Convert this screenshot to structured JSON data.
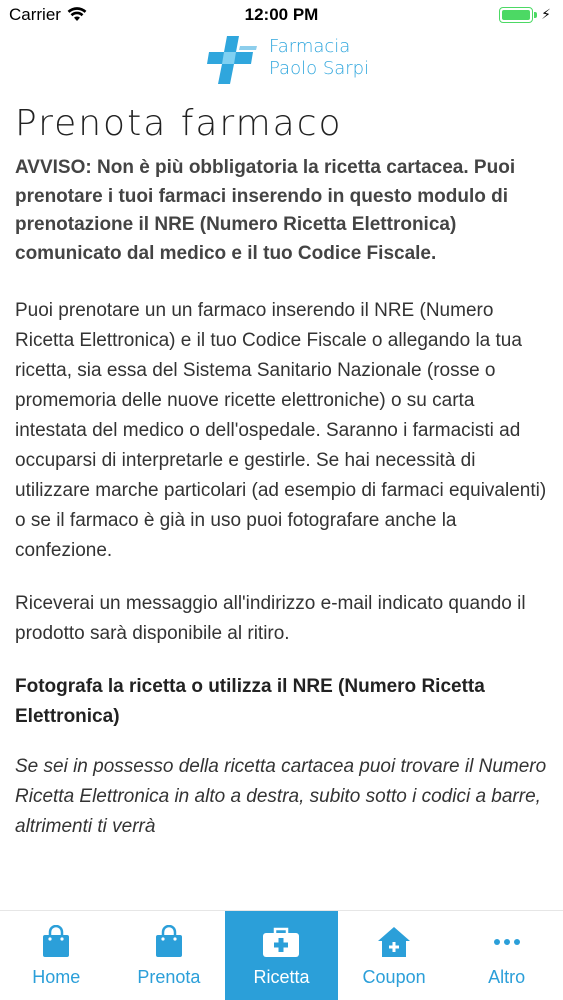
{
  "status_bar": {
    "carrier": "Carrier",
    "time": "12:00 PM",
    "battery_icon": "battery-full-icon",
    "wifi_icon": "wifi-icon"
  },
  "header": {
    "logo_line1": "Farmacia",
    "logo_line2": "Paolo Sarpi",
    "logo_icon": "pharmacy-cross-icon",
    "brand_color": "#2fa6dd"
  },
  "main": {
    "title": "Prenota farmaco",
    "notice": "AVVISO: Non è più obbligatoria la ricetta cartacea. Puoi prenotare i tuoi farmaci inserendo in questo modulo di prenotazione il NRE (Numero Ricetta Elettronica) comunicato dal medico e il tuo Codice Fiscale.",
    "paragraph1": "Puoi prenotare un un farmaco inserendo il NRE (Numero Ricetta Elettronica) e il tuo Codice Fiscale o allegando la tua ricetta, sia essa del Sistema Sanitario Nazionale (rosse o promemoria delle nuove ricette elettroniche) o su carta intestata del medico o dell'ospedale. Saranno i farmacisti ad occuparsi di interpretarle e gestirle. Se hai necessità di utilizzare marche particolari (ad esempio di farmaci equivalenti) o se il farmaco è già in uso puoi fotografare anche la confezione.",
    "paragraph2": "Riceverai un messaggio all'indirizzo e-mail indicato quando il prodotto sarà disponibile al ritiro.",
    "section_heading": "Fotografa la ricetta o utilizza il NRE (Numero Ricetta Elettronica)",
    "italic_text": "Se sei in possesso della ricetta cartacea puoi trovare il Numero Ricetta Elettronica in alto a destra, subito sotto i codici a barre, altrimenti ti verrà"
  },
  "tab_bar": {
    "accent_color": "#2b9fd9",
    "tabs": [
      {
        "label": "Home",
        "icon": "shopping-bag-icon",
        "active": false
      },
      {
        "label": "Prenota",
        "icon": "shopping-bag-icon",
        "active": false
      },
      {
        "label": "Ricetta",
        "icon": "first-aid-kit-icon",
        "active": true
      },
      {
        "label": "Coupon",
        "icon": "house-plus-icon",
        "active": false
      },
      {
        "label": "Altro",
        "icon": "more-dots-icon",
        "active": false
      }
    ]
  }
}
